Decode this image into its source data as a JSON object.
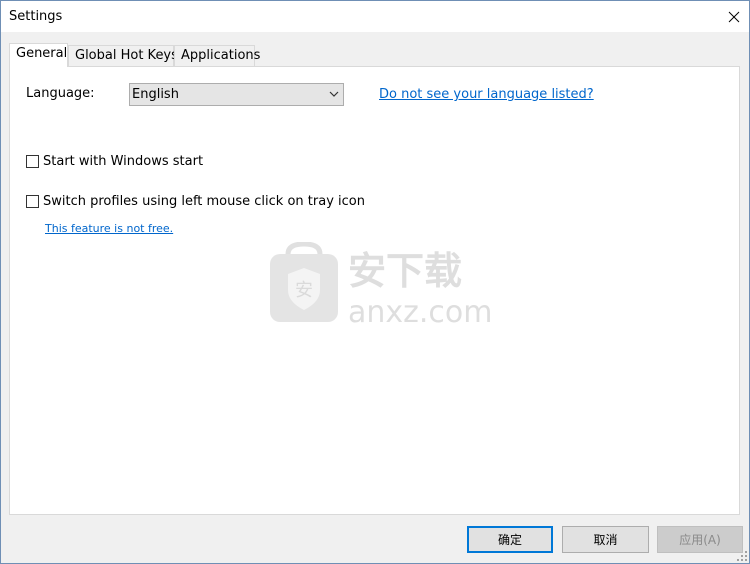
{
  "window": {
    "title": "Settings"
  },
  "tabs": [
    {
      "label": "General"
    },
    {
      "label": "Global Hot Keys"
    },
    {
      "label": "Applications"
    }
  ],
  "general": {
    "language_label": "Language:",
    "language_selected": "English",
    "language_link": "Do not see your language listed?",
    "start_with_windows": "Start with Windows start",
    "switch_profiles": "Switch profiles using left mouse click on tray icon",
    "feature_not_free": "This feature is not free."
  },
  "watermark": {
    "text": "anxz.com",
    "cn_text": "安下载"
  },
  "buttons": {
    "ok": "确定",
    "cancel": "取消",
    "apply": "应用(A)"
  },
  "colors": {
    "link": "#0066cc",
    "accent": "#0078d7",
    "panel": "#ffffff",
    "window_bg": "#f0f0f0"
  }
}
